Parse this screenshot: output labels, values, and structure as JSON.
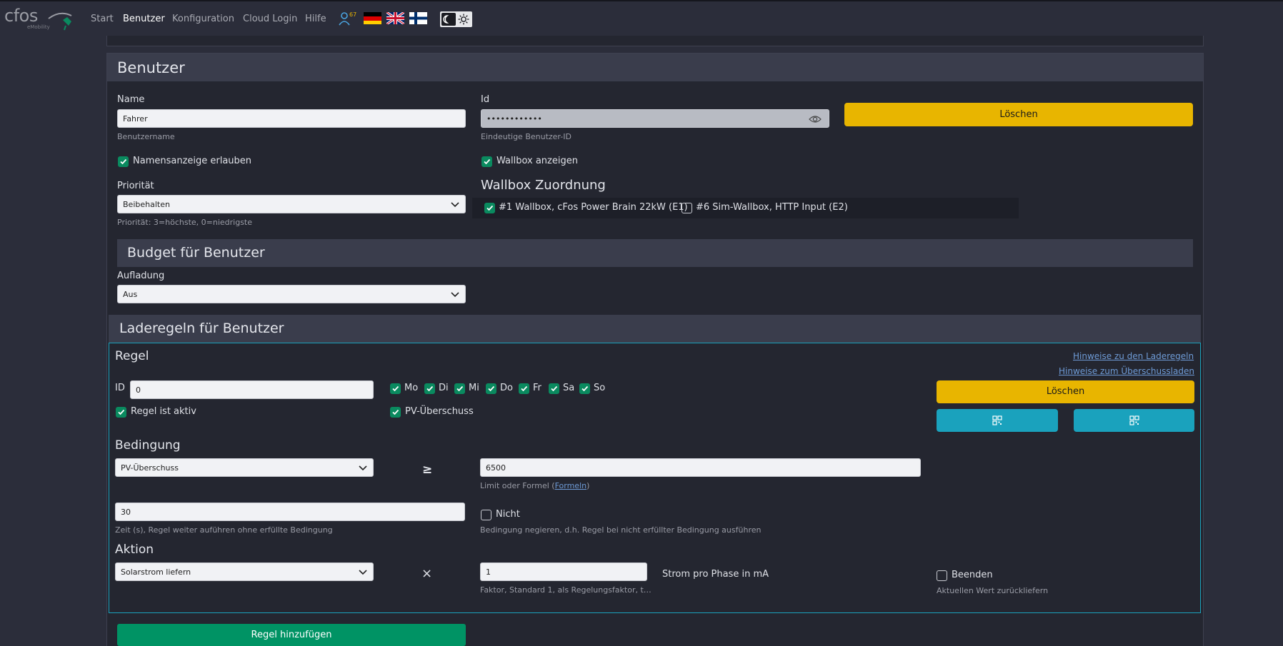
{
  "nav": {
    "logo": "cfos",
    "logo_sub": "eMobility",
    "links": [
      "Start",
      "Benutzer",
      "Konfiguration",
      "Cloud Login",
      "Hilfe"
    ],
    "active": "Benutzer",
    "user_count": "67",
    "flags": [
      "de-flag",
      "uk-flag",
      "fi-flag"
    ],
    "mode_toggle": [
      "dark-mode-icon",
      "light-mode-icon"
    ]
  },
  "user": {
    "title": "Benutzer",
    "name_label": "Name",
    "name_value": "Fahrer",
    "name_hint": "Benutzername",
    "id_label": "Id",
    "id_value": "••••••••••••",
    "id_hint": "Eindeutige Benutzer-ID",
    "delete_label": "Löschen",
    "allow_name_label": "Namensanzeige erlauben",
    "show_wallbox_label": "Wallbox anzeigen",
    "priority_label": "Priorität",
    "priority_value": "Beibehalten",
    "priority_hint": "Priorität: 3=höchste, 0=niedrigste",
    "wallbox_title": "Wallbox Zuordnung",
    "wallboxes": [
      {
        "label": "#1 Wallbox, cFos Power Brain 22kW (E1)",
        "checked": true
      },
      {
        "label": "#6 Sim-Wallbox, HTTP Input (E2)",
        "checked": false
      }
    ]
  },
  "budget": {
    "title": "Budget für Benutzer",
    "charge_label": "Aufladung",
    "charge_value": "Aus"
  },
  "rules": {
    "title": "Laderegeln für Benutzer",
    "rule_title": "Regel",
    "link_rules": "Hinweise zu den Laderegeln",
    "link_surplus": "Hinweise zum Überschussladen",
    "id_label": "ID",
    "id_value": "0",
    "days": [
      "Mo",
      "Di",
      "Mi",
      "Do",
      "Fr",
      "Sa",
      "So"
    ],
    "active_label": "Regel ist aktiv",
    "pv_label": "PV-Überschuss",
    "delete_label": "Löschen",
    "teal_icons": [
      "qr-code-icon",
      "qr-code-icon"
    ],
    "condition_title": "Bedingung",
    "condition_value": "PV-Überschuss",
    "operator": "≥",
    "limit_value": "6500",
    "limit_hint_prefix": "Limit oder Formel (",
    "limit_hint_link": "Formeln",
    "limit_hint_suffix": ")",
    "time_value": "30",
    "time_hint": "Zeit (s), Regel weiter auführen ohne erfüllte Bedingung",
    "not_label": "Nicht",
    "not_hint": "Bedingung negieren, d.h. Regel bei nicht erfüllter Bedingung ausführen",
    "action_title": "Aktion",
    "action_value": "Solarstrom liefern",
    "multiply": "×",
    "factor_value": "1",
    "factor_hint": "Faktor, Standard 1, als Regelungsfaktor, t…",
    "unit_label": "Strom pro Phase in mA",
    "end_label": "Beenden",
    "end_hint": "Aktuellen Wert zurückliefern",
    "add_label": "Regel hinzufügen"
  },
  "colors": {
    "bg": "#2b2d3a",
    "panel": "#242630",
    "header": "#3a3d4c",
    "yellow": "#e8b500",
    "teal": "#1aa2bd",
    "green": "#009364",
    "check": "#0a8a5f"
  }
}
